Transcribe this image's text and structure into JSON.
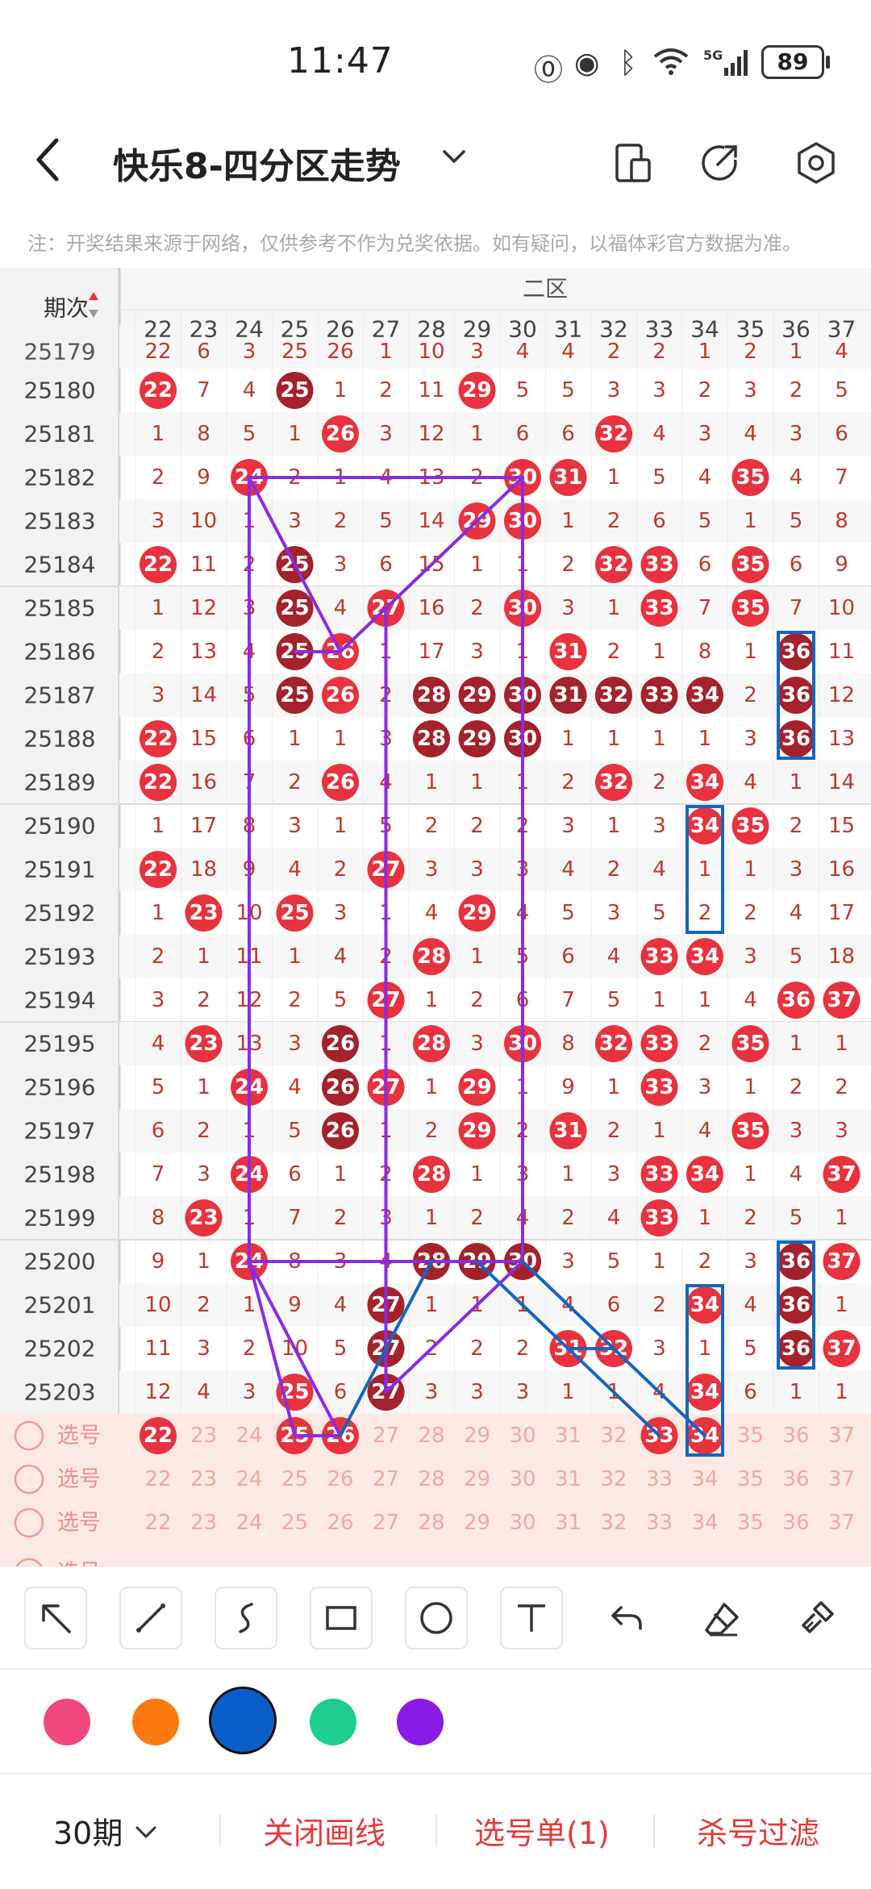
{
  "status_bar": {
    "time": "11:47",
    "battery": "89"
  },
  "header": {
    "back_icon": "back-arrow-icon",
    "title": "快乐8-四分区走势",
    "title_dropdown_icon": "chevron-down-icon",
    "icons": [
      "layout-icon",
      "share-icon",
      "settings-icon"
    ]
  },
  "notice": "注：开奖结果来源于网络，仅供参考不作为兑奖依据。如有疑问，以福体彩官方数据为准。",
  "table": {
    "period_header": "期次",
    "zone_header": "二区",
    "columns": [
      "22",
      "23",
      "24",
      "25",
      "26",
      "27",
      "28",
      "29",
      "30",
      "31",
      "32",
      "33",
      "34",
      "35",
      "36",
      "37"
    ],
    "partial_top_row": {
      "period": "25179",
      "cells": [
        "22",
        "6",
        "3",
        "25",
        "26",
        "1",
        "10",
        "3",
        "4",
        "4",
        "2",
        "2",
        "1",
        "2",
        "1",
        "4"
      ]
    },
    "rows": [
      {
        "period": "25180",
        "cells": [
          "22",
          "7",
          "4",
          "25",
          "1",
          "2",
          "11",
          "29",
          "5",
          "5",
          "3",
          "3",
          "2",
          "3",
          "2",
          "5"
        ],
        "hits": [
          0,
          3,
          7
        ],
        "dark": [
          3
        ]
      },
      {
        "period": "25181",
        "cells": [
          "1",
          "8",
          "5",
          "1",
          "26",
          "3",
          "12",
          "1",
          "6",
          "6",
          "32",
          "4",
          "3",
          "4",
          "3",
          "6"
        ],
        "hits": [
          4,
          10
        ],
        "dark": []
      },
      {
        "period": "25182",
        "cells": [
          "2",
          "9",
          "24",
          "2",
          "1",
          "4",
          "13",
          "2",
          "30",
          "31",
          "1",
          "5",
          "4",
          "35",
          "4",
          "7"
        ],
        "hits": [
          2,
          8,
          9,
          13
        ],
        "dark": []
      },
      {
        "period": "25183",
        "cells": [
          "3",
          "10",
          "1",
          "3",
          "2",
          "5",
          "14",
          "29",
          "30",
          "1",
          "2",
          "6",
          "5",
          "1",
          "5",
          "8"
        ],
        "hits": [
          7,
          8
        ],
        "dark": []
      },
      {
        "period": "25184",
        "cells": [
          "22",
          "11",
          "2",
          "25",
          "3",
          "6",
          "15",
          "1",
          "1",
          "2",
          "32",
          "33",
          "6",
          "35",
          "6",
          "9"
        ],
        "hits": [
          0,
          3,
          10,
          11,
          13
        ],
        "dark": [
          3
        ]
      },
      {
        "period": "25185",
        "cells": [
          "1",
          "12",
          "3",
          "25",
          "4",
          "27",
          "16",
          "2",
          "30",
          "3",
          "1",
          "33",
          "7",
          "35",
          "7",
          "10"
        ],
        "hits": [
          3,
          5,
          8,
          11,
          13
        ],
        "dark": [
          3
        ]
      },
      {
        "period": "25186",
        "cells": [
          "2",
          "13",
          "4",
          "25",
          "26",
          "1",
          "17",
          "3",
          "1",
          "31",
          "2",
          "1",
          "8",
          "1",
          "36",
          "11"
        ],
        "hits": [
          3,
          4,
          9,
          14
        ],
        "dark": [
          3,
          14
        ]
      },
      {
        "period": "25187",
        "cells": [
          "3",
          "14",
          "5",
          "25",
          "26",
          "2",
          "28",
          "29",
          "30",
          "31",
          "32",
          "33",
          "34",
          "2",
          "36",
          "12"
        ],
        "hits": [
          3,
          4,
          6,
          7,
          8,
          9,
          10,
          11,
          12,
          14
        ],
        "dark": [
          3,
          6,
          7,
          8,
          9,
          10,
          11,
          12,
          14
        ]
      },
      {
        "period": "25188",
        "cells": [
          "22",
          "15",
          "6",
          "1",
          "1",
          "3",
          "28",
          "29",
          "30",
          "1",
          "1",
          "1",
          "1",
          "3",
          "36",
          "13"
        ],
        "hits": [
          0,
          6,
          7,
          8,
          14
        ],
        "dark": [
          6,
          7,
          8,
          14
        ]
      },
      {
        "period": "25189",
        "cells": [
          "22",
          "16",
          "7",
          "2",
          "26",
          "4",
          "1",
          "1",
          "1",
          "2",
          "32",
          "2",
          "34",
          "4",
          "1",
          "14"
        ],
        "hits": [
          0,
          4,
          10,
          12
        ],
        "dark": []
      },
      {
        "period": "25190",
        "cells": [
          "1",
          "17",
          "8",
          "3",
          "1",
          "5",
          "2",
          "2",
          "2",
          "3",
          "1",
          "3",
          "34",
          "35",
          "2",
          "15"
        ],
        "hits": [
          12,
          13
        ],
        "dark": []
      },
      {
        "period": "25191",
        "cells": [
          "22",
          "18",
          "9",
          "4",
          "2",
          "27",
          "3",
          "3",
          "3",
          "4",
          "2",
          "4",
          "1",
          "1",
          "3",
          "16"
        ],
        "hits": [
          0,
          5
        ],
        "dark": []
      },
      {
        "period": "25192",
        "cells": [
          "1",
          "23",
          "10",
          "25",
          "3",
          "1",
          "4",
          "29",
          "4",
          "5",
          "3",
          "5",
          "2",
          "2",
          "4",
          "17"
        ],
        "hits": [
          1,
          3,
          7
        ],
        "dark": []
      },
      {
        "period": "25193",
        "cells": [
          "2",
          "1",
          "11",
          "1",
          "4",
          "2",
          "28",
          "1",
          "5",
          "6",
          "4",
          "33",
          "34",
          "3",
          "5",
          "18"
        ],
        "hits": [
          6,
          11,
          12
        ],
        "dark": []
      },
      {
        "period": "25194",
        "cells": [
          "3",
          "2",
          "12",
          "2",
          "5",
          "27",
          "1",
          "2",
          "6",
          "7",
          "5",
          "1",
          "1",
          "4",
          "36",
          "37"
        ],
        "hits": [
          5,
          14,
          15
        ],
        "dark": []
      },
      {
        "period": "25195",
        "cells": [
          "4",
          "23",
          "13",
          "3",
          "26",
          "1",
          "28",
          "3",
          "30",
          "8",
          "32",
          "33",
          "2",
          "35",
          "1",
          "1"
        ],
        "hits": [
          1,
          4,
          6,
          8,
          10,
          11,
          13
        ],
        "dark": [
          4
        ]
      },
      {
        "period": "25196",
        "cells": [
          "5",
          "1",
          "24",
          "4",
          "26",
          "27",
          "1",
          "29",
          "1",
          "9",
          "1",
          "33",
          "3",
          "1",
          "2",
          "2"
        ],
        "hits": [
          2,
          4,
          5,
          7,
          11
        ],
        "dark": [
          4
        ]
      },
      {
        "period": "25197",
        "cells": [
          "6",
          "2",
          "1",
          "5",
          "26",
          "1",
          "2",
          "29",
          "2",
          "31",
          "2",
          "1",
          "4",
          "35",
          "3",
          "3"
        ],
        "hits": [
          4,
          7,
          9,
          13
        ],
        "dark": [
          4
        ]
      },
      {
        "period": "25198",
        "cells": [
          "7",
          "3",
          "24",
          "6",
          "1",
          "2",
          "28",
          "1",
          "3",
          "1",
          "3",
          "33",
          "34",
          "1",
          "4",
          "37"
        ],
        "hits": [
          2,
          6,
          11,
          12,
          15
        ],
        "dark": []
      },
      {
        "period": "25199",
        "cells": [
          "8",
          "23",
          "1",
          "7",
          "2",
          "3",
          "1",
          "2",
          "4",
          "2",
          "4",
          "33",
          "1",
          "2",
          "5",
          "1"
        ],
        "hits": [
          1,
          11
        ],
        "dark": []
      },
      {
        "period": "25200",
        "cells": [
          "9",
          "1",
          "24",
          "8",
          "3",
          "4",
          "28",
          "29",
          "30",
          "3",
          "5",
          "1",
          "2",
          "3",
          "36",
          "37"
        ],
        "hits": [
          2,
          6,
          7,
          8,
          14,
          15
        ],
        "dark": [
          6,
          7,
          8,
          14
        ]
      },
      {
        "period": "25201",
        "cells": [
          "10",
          "2",
          "1",
          "9",
          "4",
          "27",
          "1",
          "1",
          "1",
          "4",
          "6",
          "2",
          "34",
          "4",
          "36",
          "1"
        ],
        "hits": [
          5,
          12,
          14
        ],
        "dark": [
          5,
          14
        ]
      },
      {
        "period": "25202",
        "cells": [
          "11",
          "3",
          "2",
          "10",
          "5",
          "27",
          "2",
          "2",
          "2",
          "31",
          "32",
          "3",
          "1",
          "5",
          "36",
          "37"
        ],
        "hits": [
          5,
          9,
          10,
          14,
          15
        ],
        "dark": [
          5,
          14
        ]
      },
      {
        "period": "25203",
        "cells": [
          "12",
          "4",
          "3",
          "25",
          "6",
          "27",
          "3",
          "3",
          "3",
          "1",
          "1",
          "4",
          "34",
          "6",
          "1",
          "1"
        ],
        "hits": [
          3,
          5,
          12
        ],
        "dark": [
          5
        ]
      }
    ],
    "select_rows": [
      {
        "label": "选号",
        "hits": [
          0,
          3,
          4,
          11,
          12
        ]
      },
      {
        "label": "选号",
        "hits": []
      },
      {
        "label": "选号",
        "hits": []
      }
    ],
    "partial_bottom_label": "选号"
  },
  "toolbar": {
    "tools": [
      "arrow-tool-icon",
      "line-tool-icon",
      "curve-tool-icon",
      "rectangle-tool-icon",
      "circle-tool-icon",
      "text-tool-icon",
      "undo-icon",
      "eraser-icon",
      "clear-brush-icon"
    ]
  },
  "palette": {
    "colors": [
      "#f0487d",
      "#fa7a10",
      "#0a5ec8",
      "#1ecf8e",
      "#8a1ae6"
    ],
    "selected": 2
  },
  "bottom_bar": {
    "periods_label": "30期",
    "close_drawing": "关闭画线",
    "selection_list": "选号单(1)",
    "kill_filter": "杀号过滤"
  },
  "colors": {
    "hit_red": "#e8333e",
    "hit_dark": "#a4222b",
    "miss_text": "#c0392b",
    "drawing_purple": "#8a2be2",
    "drawing_blue": "#1565c0",
    "select_row_bg": "#fde9e4"
  }
}
